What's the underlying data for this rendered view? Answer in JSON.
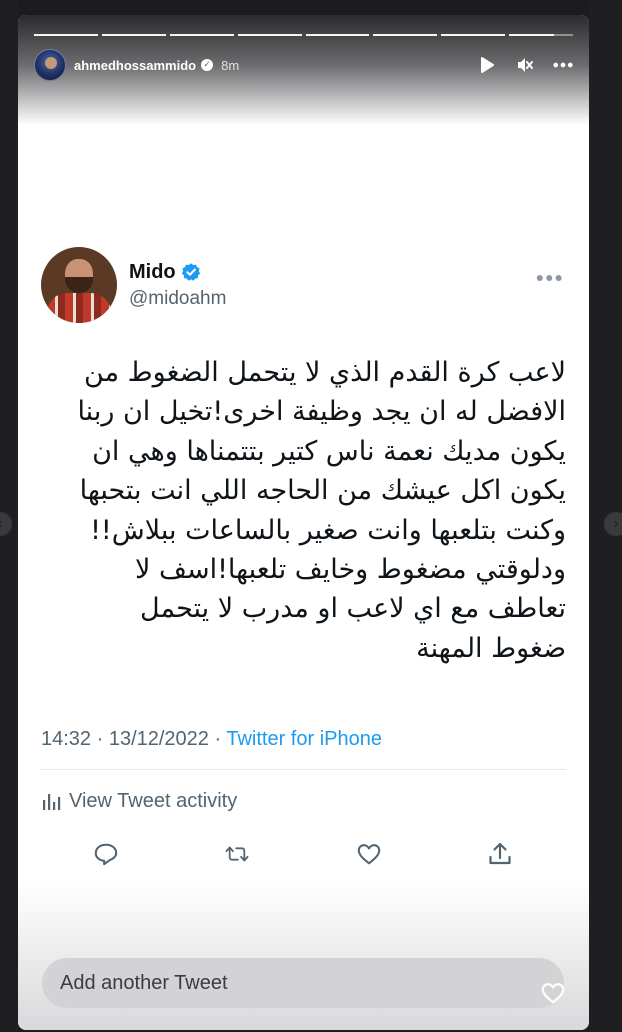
{
  "story": {
    "username": "ahmedhossammido",
    "time": "8m",
    "progress_segments": 8,
    "active_segment_fraction": 0.7
  },
  "tweet": {
    "display_name": "Mido",
    "handle": "@midoahm",
    "text": "لاعب كرة القدم الذي لا يتحمل الضغوط من\nالافضل له ان يجد وظيفة اخرى!تخيل ان ربنا\nيكون مديك نعمة ناس كتير بتتمناها وهي ان\nيكون اكل عيشك من الحاجه اللي انت بتحبها\nوكنت بتلعبها وانت صغير بالساعات ببلاش!!\nودلوقتي مضغوط وخايف تلعبها!اسف لا\nتعاطف مع اي لاعب او مدرب لا يتحمل\nضغوط المهنة",
    "timestamp": "14:32 · 13/12/2022 · ",
    "source": "Twitter for iPhone",
    "activity_label": "View Tweet activity"
  },
  "reply": {
    "placeholder": "Add another Tweet"
  },
  "colors": {
    "twitter_blue": "#1d9bf0",
    "secondary_text": "#536471",
    "primary_text": "#0f1419"
  }
}
